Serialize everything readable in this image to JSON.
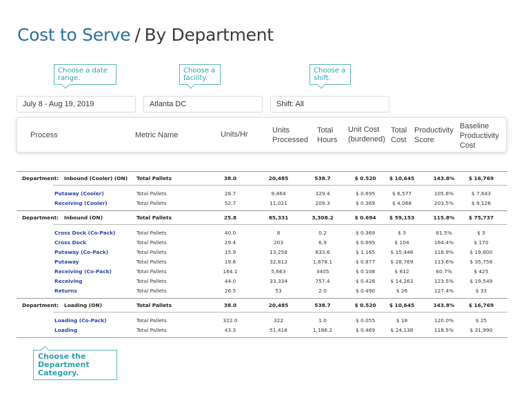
{
  "title": {
    "main": "Cost to Serve",
    "separator": "/",
    "sub": "By Department"
  },
  "callouts": {
    "date": "Choose a date range.",
    "facility": "Choose a facility.",
    "shift": "Choose a shift.",
    "department": "Choose the Department Category."
  },
  "filters": {
    "date_range": "July 8 - Aug 19, 2019",
    "facility": "Atlanta DC",
    "shift": "Shift: All"
  },
  "columns": {
    "process": "Process",
    "metric": "Metric Name",
    "units_hr": "Units/Hr",
    "units_processed_1": "Units",
    "units_processed_2": "Processed",
    "total_hours_1": "Total",
    "total_hours_2": "Hours",
    "unit_cost_1": "Unit Cost",
    "unit_cost_2": "(burdened)",
    "total_cost_1": "Total",
    "total_cost_2": "Cost",
    "prod_score_1": "Productivity",
    "prod_score_2": "Score",
    "baseline_1": "Baseline",
    "baseline_2": "Productivity",
    "baseline_3": "Cost"
  },
  "dept_label": "Department:",
  "departments": [
    {
      "name": "Inbound (Cooler) (ON)",
      "metric": "Total Pallets",
      "units_hr": "38.0",
      "units_processed": "20,485",
      "total_hours": "538.7",
      "unit_cost": "$ 0.520",
      "total_cost": "$ 10,645",
      "prod_score": "143.8%",
      "baseline_cost": "$ 16,769",
      "processes": [
        {
          "name": "Putaway (Cooler)",
          "metric": "Total Pallets",
          "units_hr": "28.7",
          "units_processed": "9,464",
          "total_hours": "329.4",
          "unit_cost": "$ 0.695",
          "total_cost": "$ 6,577",
          "prod_score": "105.8%",
          "baseline_cost": "$ 7,643"
        },
        {
          "name": "Receiving (Cooler)",
          "metric": "Total Pallets",
          "units_hr": "52.7",
          "units_processed": "11,021",
          "total_hours": "209.3",
          "unit_cost": "$ 0.369",
          "total_cost": "$ 4,068",
          "prod_score": "203.5%",
          "baseline_cost": "$ 9,126"
        }
      ]
    },
    {
      "name": "Inbound (ON)",
      "metric": "Total Pallets",
      "units_hr": "25.8",
      "units_processed": "85,331",
      "total_hours": "3,308.2",
      "unit_cost": "$ 0.694",
      "total_cost": "$ 59,153",
      "prod_score": "115.8%",
      "baseline_cost": "$ 75,737",
      "processes": [
        {
          "name": "Cross Dock (Co-Pack)",
          "metric": "Total Pallets",
          "units_hr": "40.0",
          "units_processed": "8",
          "total_hours": "0.2",
          "unit_cost": "$ 0.369",
          "total_cost": "$ 3",
          "prod_score": "81.5%",
          "baseline_cost": "$ 3"
        },
        {
          "name": "Cross Dock",
          "metric": "Total Pallets",
          "units_hr": "29.4",
          "units_processed": "203",
          "total_hours": "6.9",
          "unit_cost": "$ 0.695",
          "total_cost": "$ 104",
          "prod_score": "164.4%",
          "baseline_cost": "$ 170"
        },
        {
          "name": "Putaway (Co-Pack)",
          "metric": "Total Pallets",
          "units_hr": "15.9",
          "units_processed": "13,258",
          "total_hours": "833.6",
          "unit_cost": "$ 1.165",
          "total_cost": "$ 15,446",
          "prod_score": "118.9%",
          "baseline_cost": "$ 19,800"
        },
        {
          "name": "Putaway",
          "metric": "Total Pallets",
          "units_hr": "19.6",
          "units_processed": "32,812",
          "total_hours": "1,678.1",
          "unit_cost": "$ 0.877",
          "total_cost": "$ 28,769",
          "prod_score": "113.6%",
          "baseline_cost": "$ 35,756"
        },
        {
          "name": "Receiving (Co-Pack)",
          "metric": "Total Pallets",
          "units_hr": "164.1",
          "units_processed": "5,663",
          "total_hours": "3405",
          "unit_cost": "$ 0.108",
          "total_cost": "$ 612",
          "prod_score": "60.7%",
          "baseline_cost": "$ 425"
        },
        {
          "name": "Receiving",
          "metric": "Total Pallets",
          "units_hr": "44.0",
          "units_processed": "33,334",
          "total_hours": "757.4",
          "unit_cost": "$ 0.428",
          "total_cost": "$ 14,263",
          "prod_score": "123.5%",
          "baseline_cost": "$ 19,549"
        },
        {
          "name": "Returns",
          "metric": "Total Pallets",
          "units_hr": "26.5",
          "units_processed": "53",
          "total_hours": "2.0",
          "unit_cost": "$ 0.490",
          "total_cost": "$ 26",
          "prod_score": "127.4%",
          "baseline_cost": "$ 33"
        }
      ]
    },
    {
      "name": "Loading (ON)",
      "metric": "Total Pallets",
      "units_hr": "38.0",
      "units_processed": "20,485",
      "total_hours": "538.7",
      "unit_cost": "$ 0.520",
      "total_cost": "$ 10,645",
      "prod_score": "143.8%",
      "baseline_cost": "$ 16,769",
      "processes": [
        {
          "name": "Loading (Co-Pack)",
          "metric": "Total Pallets",
          "units_hr": "322.0",
          "units_processed": "322",
          "total_hours": "1.0",
          "unit_cost": "$ 0.055",
          "total_cost": "$ 18",
          "prod_score": "120.0%",
          "baseline_cost": "$ 25"
        },
        {
          "name": "Loading",
          "metric": "Total Pallets",
          "units_hr": "43.3",
          "units_processed": "51,418",
          "total_hours": "1,186.2",
          "unit_cost": "$ 0.469",
          "total_cost": "$ 24,138",
          "prod_score": "118.5%",
          "baseline_cost": "$ 31,990"
        }
      ]
    }
  ]
}
